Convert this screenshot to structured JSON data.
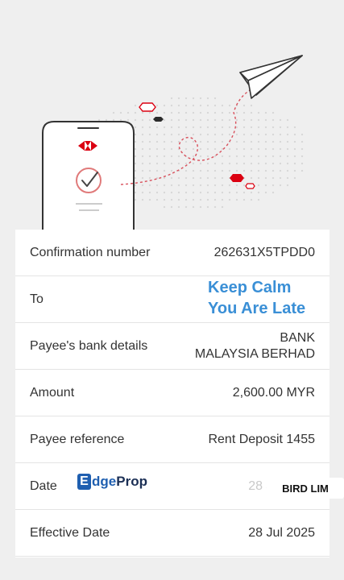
{
  "rows": [
    {
      "label": "Confirmation number",
      "value": "262631X5TPDD0"
    },
    {
      "label": "To",
      "value": ""
    },
    {
      "label": "Payee's bank details",
      "value_line1": "BANK",
      "value_line2": "MALAYSIA BERHAD"
    },
    {
      "label": "Amount",
      "value": "2,600.00 MYR"
    },
    {
      "label": "Payee reference",
      "value": "Rent Deposit 1455"
    },
    {
      "label": "Date",
      "value": "28 Jul 2025"
    },
    {
      "label": "Effective Date",
      "value": "28 Jul 2025"
    }
  ],
  "overlay": {
    "keep_calm_line1": "Keep Calm",
    "keep_calm_line2": "You Are Late",
    "edgeprop_e": "E",
    "edgeprop_text_a": "dge",
    "edgeprop_text_b": "Prop",
    "bird_lim": "BIRD LIM"
  },
  "icons": [
    "bank-logo-icon",
    "check-circle-icon",
    "paper-plane-icon"
  ],
  "colors": {
    "background": "#efefef",
    "card": "#ffffff",
    "brand_red": "#db0011",
    "keep_calm_blue": "#3a8fd6",
    "edgeprop_blue": "#1f5fb0"
  }
}
